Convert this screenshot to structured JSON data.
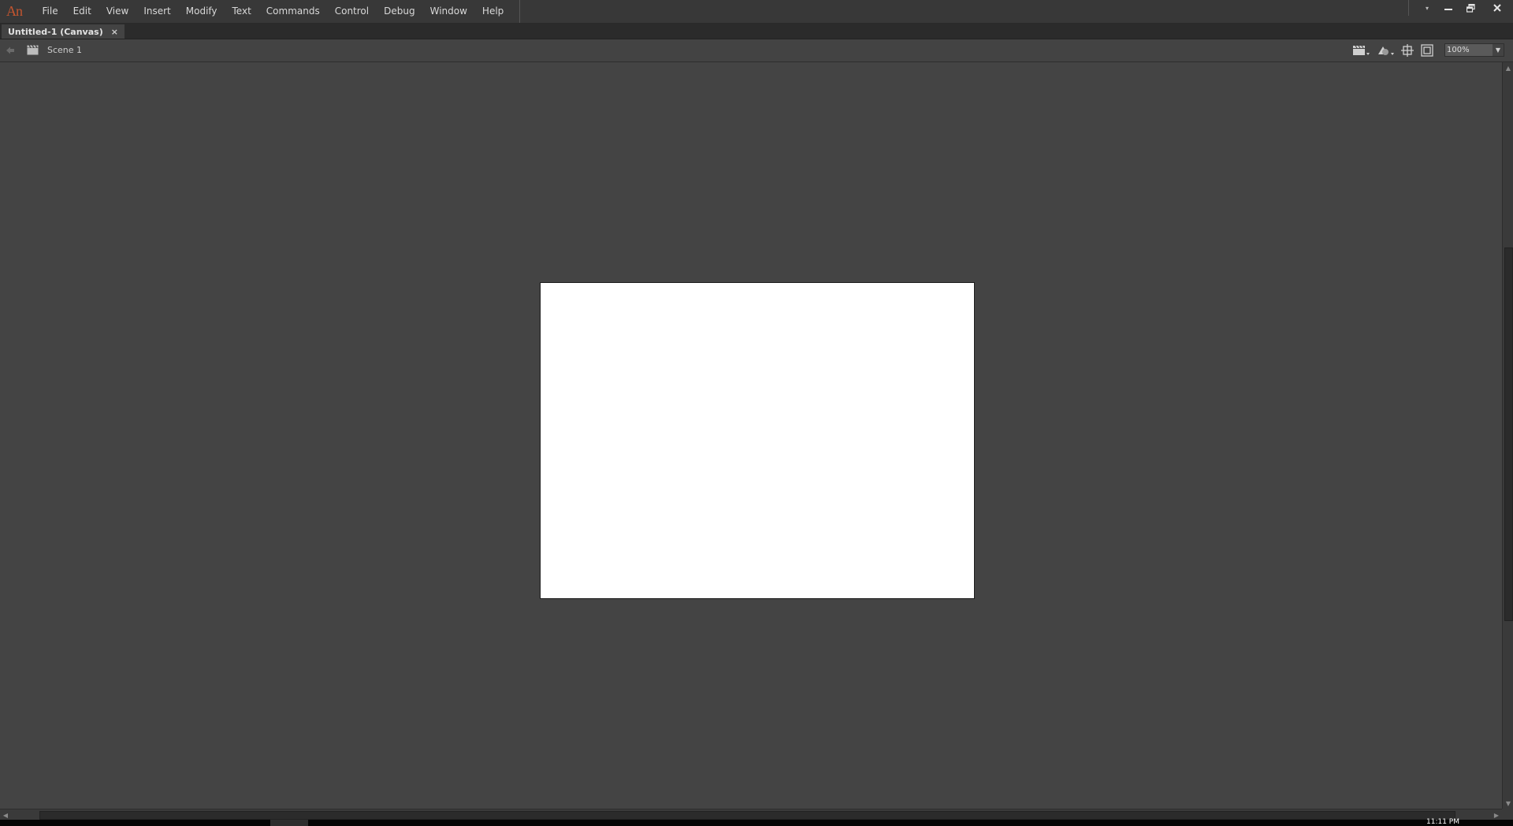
{
  "app": {
    "logo_text": "An",
    "accent_color": "#c4552f"
  },
  "menu": {
    "items": [
      {
        "label": "File"
      },
      {
        "label": "Edit"
      },
      {
        "label": "View"
      },
      {
        "label": "Insert"
      },
      {
        "label": "Modify"
      },
      {
        "label": "Text"
      },
      {
        "label": "Commands"
      },
      {
        "label": "Control"
      },
      {
        "label": "Debug"
      },
      {
        "label": "Window"
      },
      {
        "label": "Help"
      }
    ]
  },
  "window_controls": {
    "workspace_arrow": "▾",
    "minimize": "minimize-icon",
    "restore": "restore-icon",
    "close": "close-icon"
  },
  "document": {
    "tab_label": "Untitled-1 (Canvas)",
    "tab_close": "×"
  },
  "editbar": {
    "scene_label": "Scene 1",
    "icons": [
      "back-arrow-icon",
      "scene-clapper-icon",
      "edit-scene-icon",
      "edit-symbols-icon",
      "center-stage-icon",
      "clip-content-icon"
    ],
    "zoom_value": "100%"
  },
  "stage": {
    "background_color": "#ffffff"
  },
  "taskbar": {
    "clock_text": "11:11 PM"
  }
}
